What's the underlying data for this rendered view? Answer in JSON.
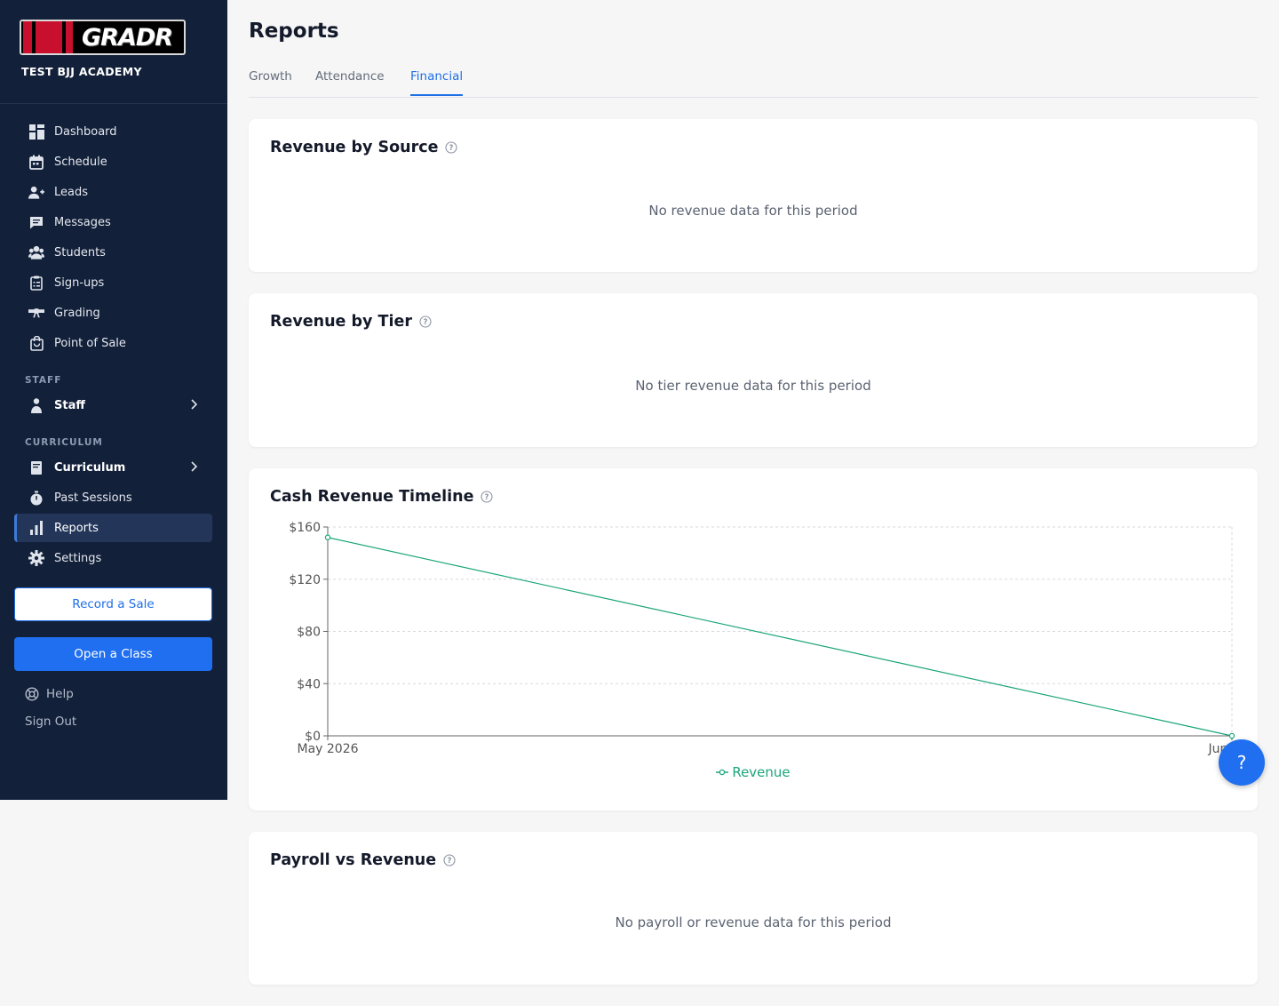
{
  "sidebar": {
    "logo_text": "GRADR",
    "academy_name": "TEST BJJ ACADEMY",
    "nav": [
      {
        "label": "Dashboard",
        "icon": "dashboard-icon"
      },
      {
        "label": "Schedule",
        "icon": "calendar-icon"
      },
      {
        "label": "Leads",
        "icon": "add-user-icon"
      },
      {
        "label": "Messages",
        "icon": "message-icon"
      },
      {
        "label": "Students",
        "icon": "students-icon"
      },
      {
        "label": "Sign-ups",
        "icon": "clipboard-icon"
      },
      {
        "label": "Grading",
        "icon": "belt-icon"
      },
      {
        "label": "Point of Sale",
        "icon": "shopping-bag-icon"
      }
    ],
    "staff_section": "STAFF",
    "staff_item": "Staff",
    "curriculum_section": "CURRICULUM",
    "curriculum_item": "Curriculum",
    "past_sessions": "Past Sessions",
    "reports": "Reports",
    "settings": "Settings",
    "record_sale": "Record a Sale",
    "open_class": "Open a Class",
    "help": "Help",
    "sign_out": "Sign Out"
  },
  "main": {
    "title": "Reports",
    "tabs": [
      "Growth",
      "Attendance",
      "Financial"
    ],
    "active_tab": "Financial",
    "cards": {
      "revenue_by_source": {
        "title": "Revenue by Source",
        "empty": "No revenue data for this period"
      },
      "revenue_by_tier": {
        "title": "Revenue by Tier",
        "empty": "No tier revenue data for this period"
      },
      "cash_revenue": {
        "title": "Cash Revenue Timeline"
      },
      "payroll_vs_revenue": {
        "title": "Payroll vs Revenue",
        "empty": "No payroll or revenue data for this period"
      }
    },
    "help_fab": "?"
  },
  "colors": {
    "sidebar_bg": "#13203a",
    "accent": "#1f6fe5",
    "series": "#1aa57a"
  },
  "chart_data": {
    "type": "line",
    "title": "Cash Revenue Timeline",
    "x": [
      "May 2026",
      "Jun 2026"
    ],
    "x_tick_labels": [
      "May 2026",
      "Jun 202"
    ],
    "series": [
      {
        "name": "Revenue",
        "values": [
          152,
          0
        ]
      }
    ],
    "y_ticks": [
      "$0",
      "$40",
      "$80",
      "$120",
      "$160"
    ],
    "ylim": [
      0,
      160
    ],
    "grid": true,
    "legend": "bottom"
  }
}
